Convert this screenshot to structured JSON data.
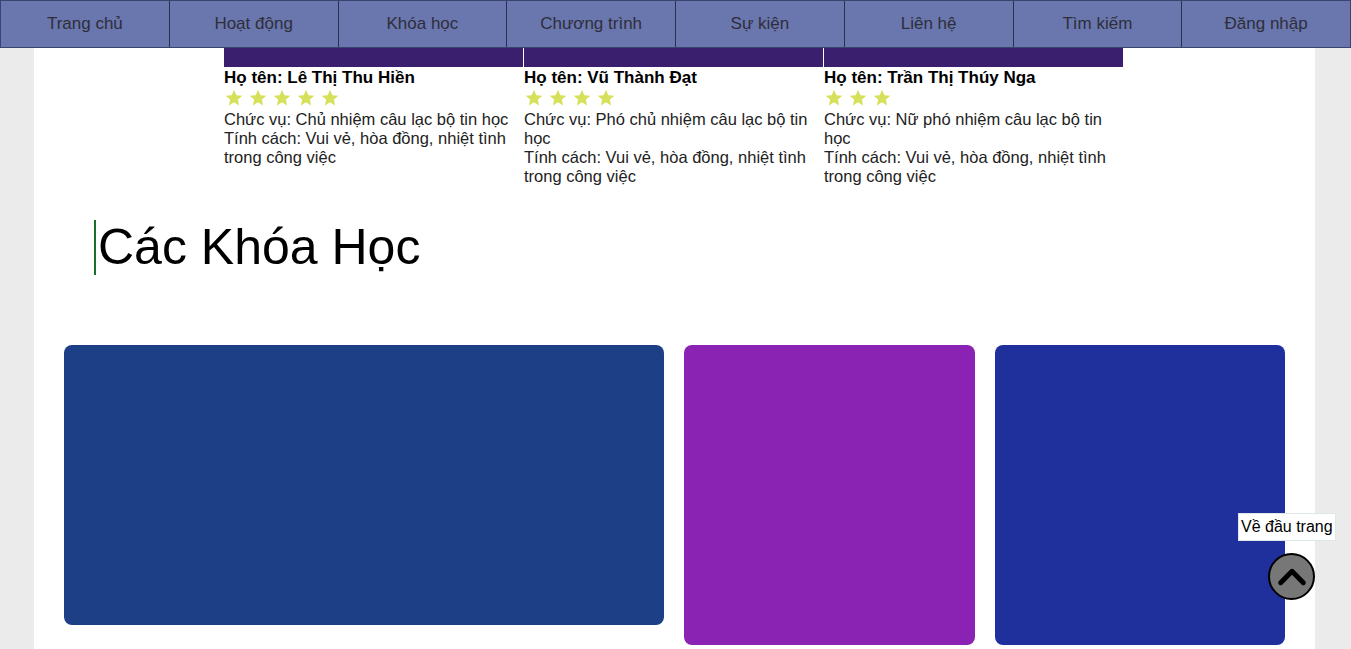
{
  "nav": {
    "items": [
      "Trang chủ",
      "Hoạt động",
      "Khóa học",
      "Chương trình",
      "Sự kiện",
      "Liên hệ",
      "Tìm kiếm",
      "Đăng nhập"
    ]
  },
  "members": [
    {
      "name": "Họ tên: Lê Thị Thu Hiền",
      "stars": 5,
      "lines": [
        "Chức vụ: Chủ nhiệm câu lạc bộ tin học",
        "Tính cách: Vui vẻ, hòa đồng, nhiệt tình",
        "trong công việc"
      ]
    },
    {
      "name": "Họ tên: Vũ Thành Đạt",
      "stars": 4,
      "lines": [
        "Chức vụ: Phó chủ nhiệm câu lạc bộ tin học",
        "Tính cách: Vui vẻ, hòa đồng, nhiệt tình",
        "trong công việc"
      ]
    },
    {
      "name": "Họ tên: Trần Thị Thúy Nga",
      "stars": 3,
      "lines": [
        "Chức vụ: Nữ phó nhiệm câu lạc bộ tin học",
        "Tính cách: Vui vẻ, hòa đồng, nhiệt tình",
        "trong công việc"
      ]
    }
  ],
  "courses_section": {
    "title": "Các Khóa Học"
  },
  "courses": [
    {
      "color": "#1d3f86"
    },
    {
      "color": "#8a22b3"
    },
    {
      "color": "#1f2f9c"
    }
  ],
  "back_to_top": {
    "tooltip": "Về đầu trang"
  }
}
